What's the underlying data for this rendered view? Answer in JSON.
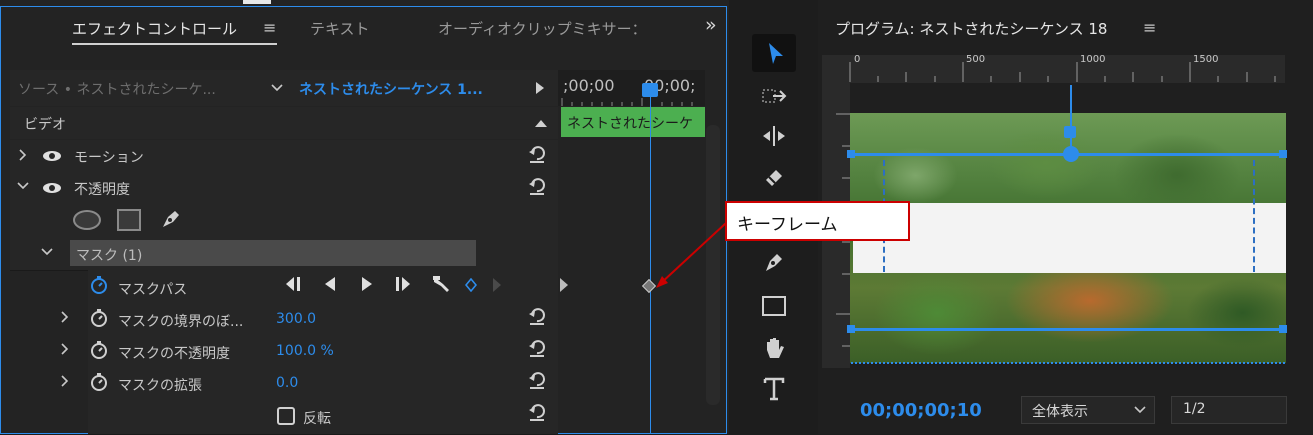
{
  "effect_controls": {
    "tabs": [
      {
        "label": "エフェクトコントロール"
      },
      {
        "label": "テキスト"
      },
      {
        "label": "オーディオクリップミキサー："
      }
    ],
    "menu_icon": "≡",
    "expand_icon": "»",
    "source_label": "ソース • ネストされたシーケ...",
    "sequence_label": "ネストされたシーケンス 1...",
    "timecode_start": ";00;00",
    "timecode_end": "00;00;",
    "clip_label": "ネストされたシーケ",
    "video_header": "ビデオ",
    "properties": {
      "motion": "モーション",
      "opacity": "不透明度",
      "mask": "マスク (1)",
      "mask_path": "マスクパス",
      "mask_feather": {
        "label": "マスクの境界のぼ...",
        "value": "300.0"
      },
      "mask_opacity": {
        "label": "マスクの不透明度",
        "value": "100.0 %"
      },
      "mask_expansion": {
        "label": "マスクの拡張",
        "value": "0.0"
      },
      "invert": "反転"
    }
  },
  "annotation": {
    "text": "キーフレーム",
    "color": "#cc0000"
  },
  "program": {
    "title": "プログラム: ネストされたシーケンス 18",
    "menu_icon": "≡",
    "ruler_ticks": [
      "0",
      "500",
      "1000",
      "1500"
    ],
    "timecode": "00;00;00;10",
    "zoom": "全体表示",
    "resolution": "1/2"
  },
  "colors": {
    "accent": "#2d8ceb",
    "clip": "#4caf50",
    "annotation": "#cc0000"
  }
}
